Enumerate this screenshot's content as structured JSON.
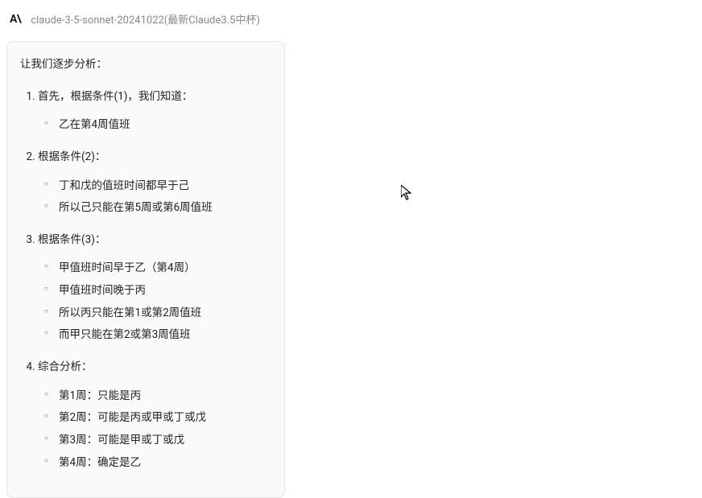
{
  "header": {
    "logo_text": "A\\",
    "model_name": "claude-3-5-sonnet-20241022(最新Claude3.5中杯)"
  },
  "response": {
    "intro": "让我们逐步分析：",
    "items": [
      {
        "title": "首先，根据条件(1)，我们知道：",
        "sub": [
          "乙在第4周值班"
        ]
      },
      {
        "title": "根据条件(2)：",
        "sub": [
          "丁和戊的值班时间都早于己",
          "所以己只能在第5周或第6周值班"
        ]
      },
      {
        "title": "根据条件(3)：",
        "sub": [
          "甲值班时间早于乙（第4周）",
          "甲值班时间晚于丙",
          "所以丙只能在第1或第2周值班",
          "而甲只能在第2或第3周值班"
        ]
      },
      {
        "title": "综合分析：",
        "sub": [
          "第1周：只能是丙",
          "第2周：可能是丙或甲或丁或戊",
          "第3周：可能是甲或丁或戊",
          "第4周：确定是乙"
        ]
      }
    ]
  }
}
